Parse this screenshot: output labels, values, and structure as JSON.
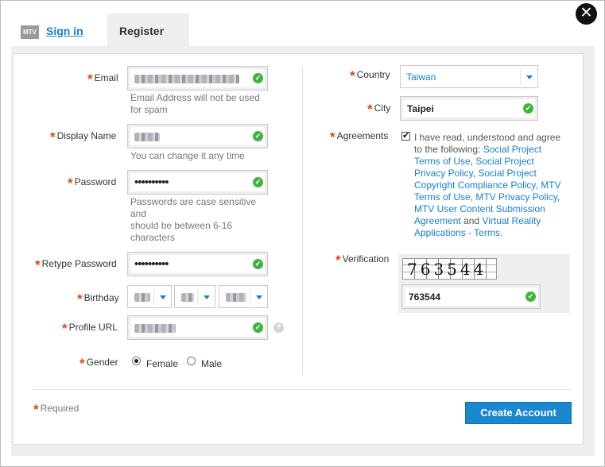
{
  "tabs": {
    "logo_text": "MTV",
    "signin": "Sign in",
    "register": "Register"
  },
  "close_label": "✕",
  "form": {
    "email": {
      "label": "Email",
      "hint": "Email Address will not be used for spam"
    },
    "display_name": {
      "label": "Display Name",
      "hint": "You can change it any time"
    },
    "password": {
      "label": "Password",
      "masked_value": "••••••••••",
      "hint_lines": [
        "Passwords are case sensitive and",
        "should be between 6-16",
        "characters"
      ]
    },
    "retype_password": {
      "label": "Retype Password",
      "masked_value": "••••••••••"
    },
    "birthday": {
      "label": "Birthday"
    },
    "profile_url": {
      "label": "Profile URL",
      "help_glyph": "?"
    },
    "gender": {
      "label": "Gender",
      "options": [
        "Female",
        "Male"
      ],
      "selected": "Female"
    },
    "country": {
      "label": "Country",
      "value": "Taiwan"
    },
    "city": {
      "label": "City",
      "value": "Taipei"
    },
    "agreements": {
      "label": "Agreements",
      "checked": true,
      "check_glyph": "✔",
      "text_intro": "I have read, understood and agree to the following: ",
      "links": [
        "Social Project Terms of Use",
        "Social Project Privacy Policy",
        "Social Project Copyright Compliance Policy",
        "MTV Terms of Use",
        "MTV Privacy Policy",
        "MTV User Content Submission Agreement",
        "Virtual Reality Applications - Terms."
      ],
      "sep_comma": ", ",
      "sep_and": " and "
    },
    "verification": {
      "label": "Verification",
      "captcha_text": "763544",
      "value": "763544"
    }
  },
  "required_mark": "*",
  "required_note": "Required",
  "submit_label": "Create Account",
  "valid_glyph": "✔",
  "colors": {
    "accent": "#1a87cf",
    "required": "#d64a13",
    "valid": "#3db53a"
  }
}
